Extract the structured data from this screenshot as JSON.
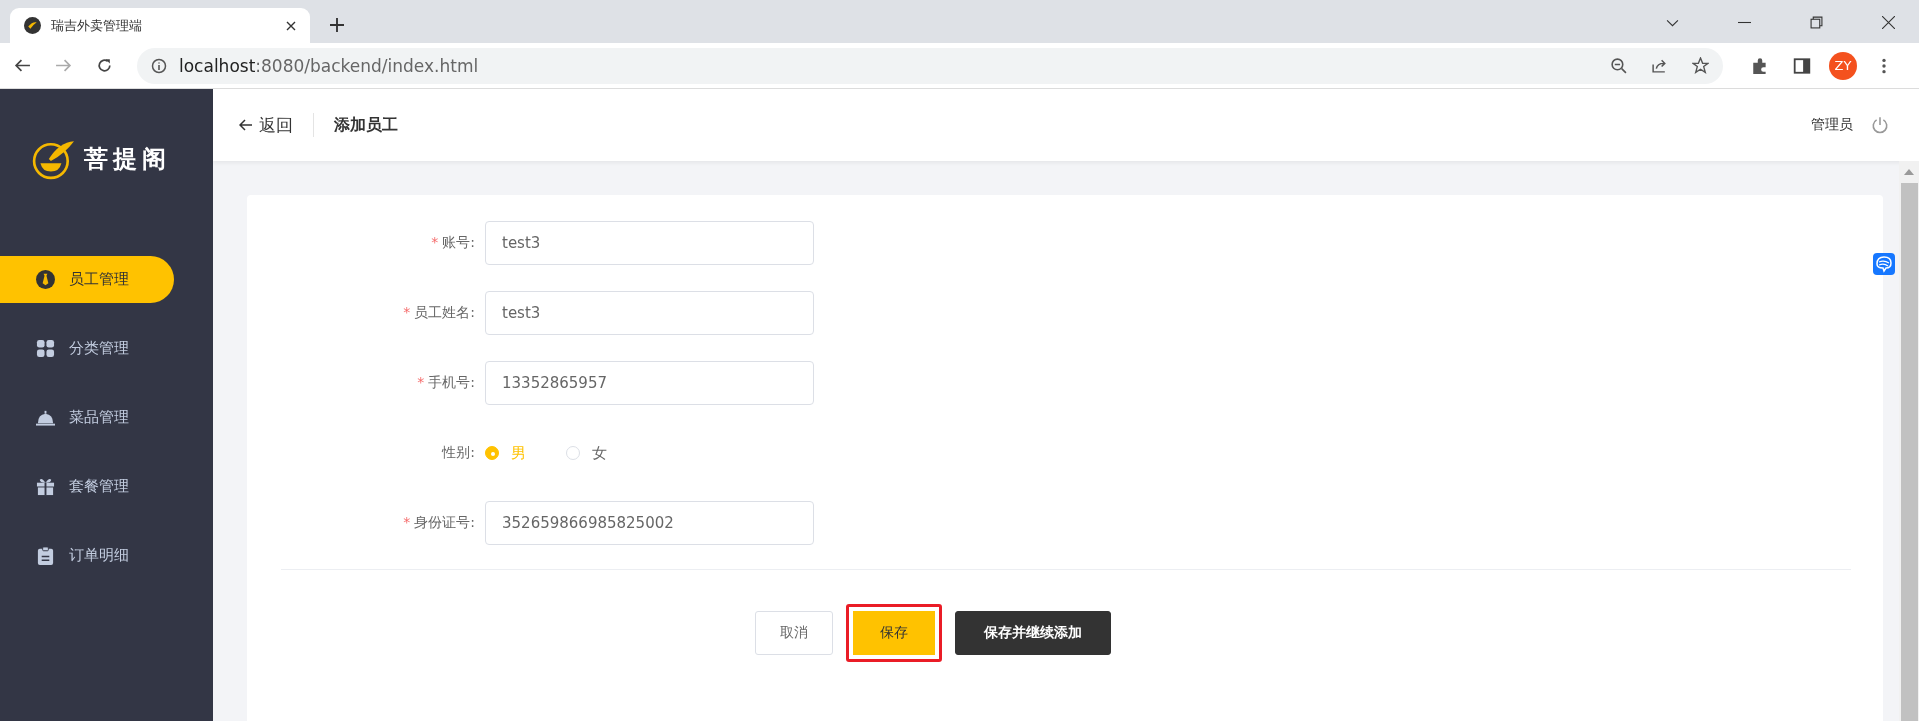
{
  "browser": {
    "tab_title": "瑞吉外卖管理端",
    "url_host": "localhost",
    "url_rest": ":8080/backend/index.html",
    "avatar": "ZY"
  },
  "sidebar": {
    "brand": "菩提阁",
    "items": [
      {
        "label": "员工管理",
        "selected": true
      },
      {
        "label": "分类管理",
        "selected": false
      },
      {
        "label": "菜品管理",
        "selected": false
      },
      {
        "label": "套餐管理",
        "selected": false
      },
      {
        "label": "订单明细",
        "selected": false
      }
    ]
  },
  "header": {
    "back": "返回",
    "title": "添加员工",
    "user": "管理员"
  },
  "form": {
    "fields": [
      {
        "kind": "input",
        "required_mark": "*",
        "label": "账号:",
        "value": "test3"
      },
      {
        "kind": "input",
        "required_mark": "*",
        "label": "员工姓名:",
        "value": "test3"
      },
      {
        "kind": "input",
        "required_mark": "*",
        "label": "手机号:",
        "value": "13352865957"
      },
      {
        "kind": "radio",
        "label": "性别:",
        "options": [
          {
            "label": "男",
            "selected": true
          },
          {
            "label": "女",
            "selected": false
          }
        ]
      },
      {
        "kind": "input",
        "required_mark": "*",
        "label": "身份证号:",
        "value": "352659866985825002"
      }
    ],
    "buttons": [
      {
        "label": "取消",
        "kind": "plain",
        "highlighted": false
      },
      {
        "label": "保存",
        "kind": "primary",
        "highlighted": true
      },
      {
        "label": "保存并继续添加",
        "kind": "dark",
        "highlighted": false
      }
    ]
  }
}
